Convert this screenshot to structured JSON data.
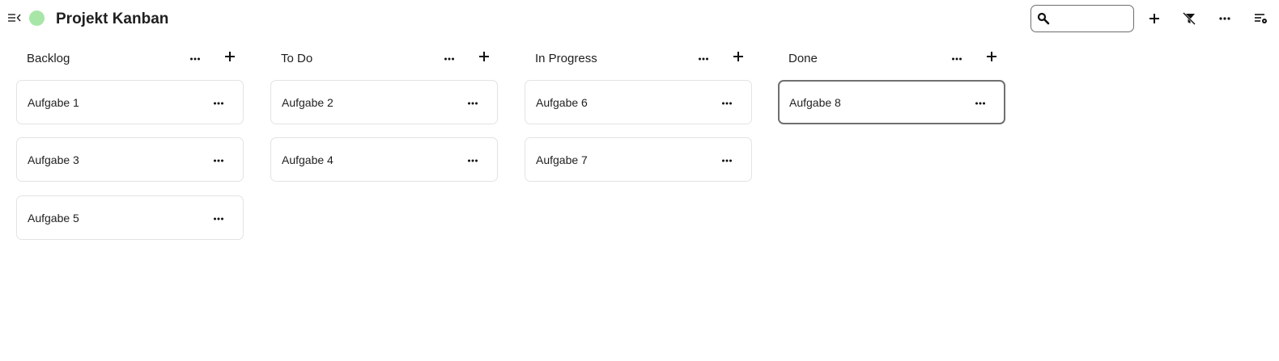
{
  "app": {
    "title": "Projekt Kanban",
    "status_color": "#a8e6a8"
  },
  "header": {
    "collapse_icon": "collapse-menu-icon",
    "search": {
      "icon": "search-icon",
      "value": "",
      "placeholder": ""
    },
    "actions": [
      {
        "name": "add-button",
        "icon": "plus-icon"
      },
      {
        "name": "clear-filter-button",
        "icon": "filter-off-icon"
      },
      {
        "name": "more-options-button",
        "icon": "more-horizontal-icon"
      },
      {
        "name": "view-settings-button",
        "icon": "view-settings-icon"
      }
    ]
  },
  "board": {
    "columns": [
      {
        "title": "Backlog",
        "cards": [
          {
            "title": "Aufgabe 1"
          },
          {
            "title": "Aufgabe 3"
          },
          {
            "title": "Aufgabe 5"
          }
        ]
      },
      {
        "title": "To Do",
        "cards": [
          {
            "title": "Aufgabe 2"
          },
          {
            "title": "Aufgabe 4"
          }
        ]
      },
      {
        "title": "In Progress",
        "cards": [
          {
            "title": "Aufgabe 6"
          },
          {
            "title": "Aufgabe 7"
          }
        ]
      },
      {
        "title": "Done",
        "cards": [
          {
            "title": "Aufgabe 8",
            "selected": true
          }
        ]
      }
    ]
  }
}
